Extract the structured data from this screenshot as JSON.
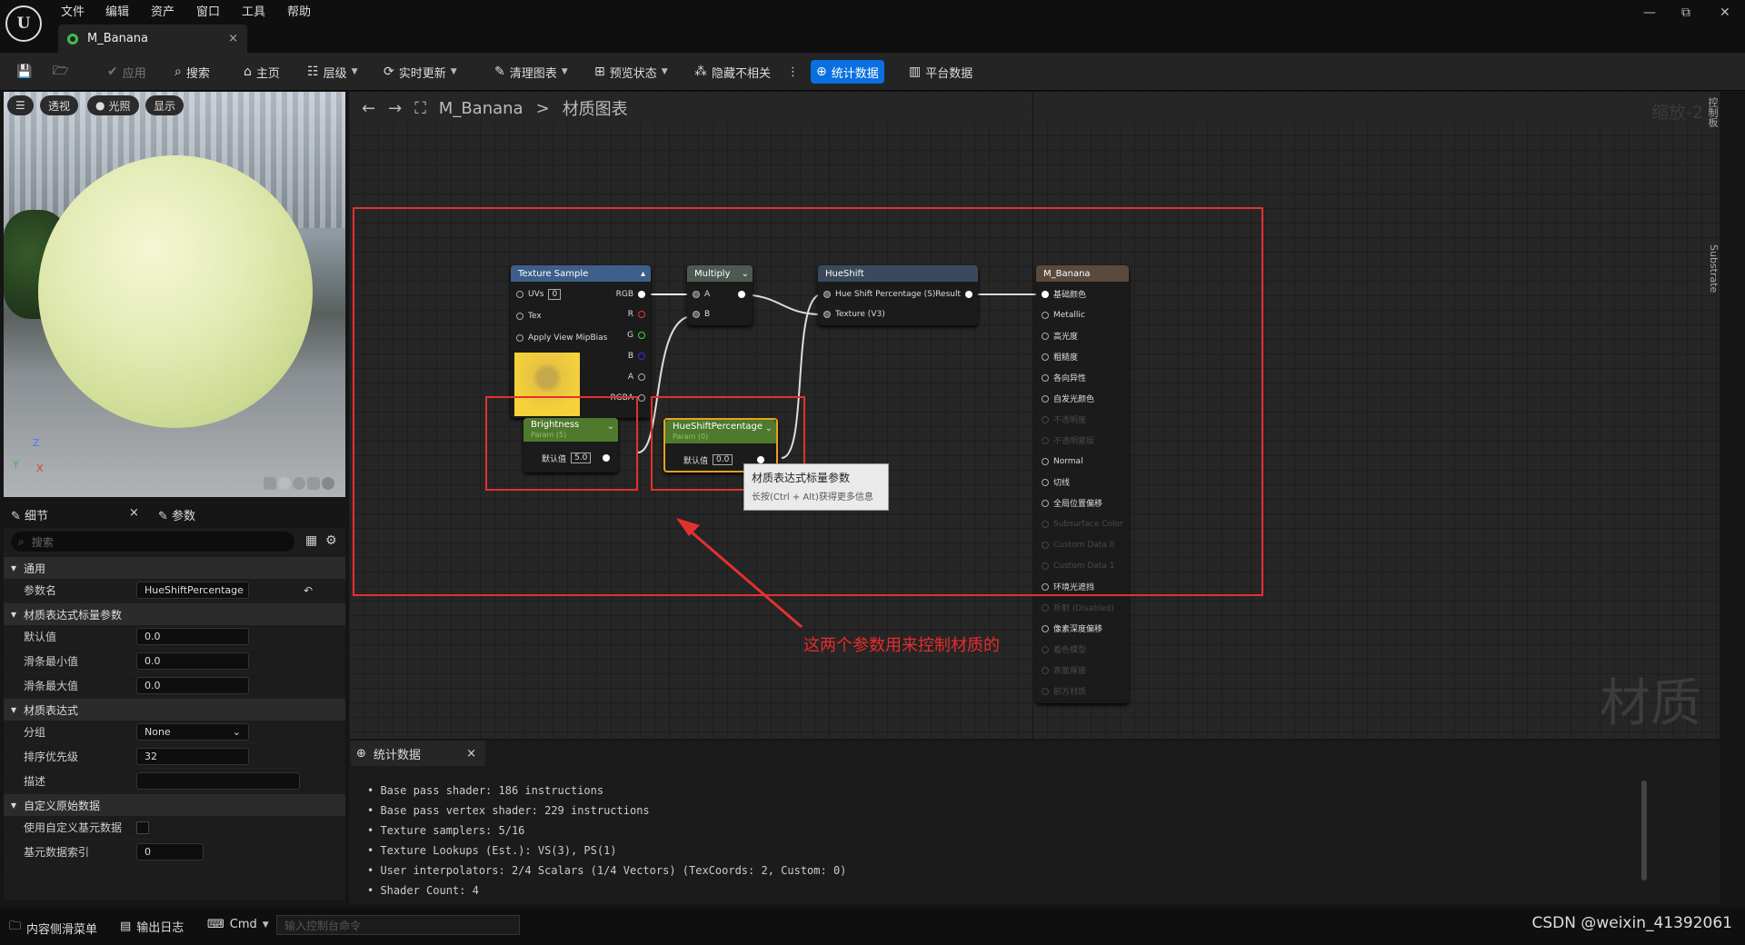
{
  "menu": {
    "items": [
      "文件",
      "编辑",
      "资产",
      "窗口",
      "工具",
      "帮助"
    ]
  },
  "doc_tab": {
    "title": "M_Banana",
    "close": "×"
  },
  "window_controls": {
    "minimize": "—",
    "restore": "⧉",
    "close": "✕"
  },
  "toolbar": {
    "save": "",
    "browse": "",
    "apply": "应用",
    "search": "搜索",
    "home": "主页",
    "hierarchy": "层级",
    "live_update": "实时更新",
    "clean_graph": "清理图表",
    "preview_state": "预览状态",
    "hide_unrelated": "隐藏不相关",
    "more": "⋮",
    "stats": "统计数据",
    "platform_stats": "平台数据"
  },
  "viewport": {
    "menu_label": "☰",
    "perspective": "透视",
    "lit": "光照",
    "show": "显示",
    "axis_z": "Z",
    "axis_x": "X",
    "axis_y": "Y"
  },
  "details": {
    "tab_details": "细节",
    "tab_params": "参数",
    "close": "×",
    "search_placeholder": "搜索",
    "sections": {
      "general": "通用",
      "scalar_param": "材质表达式标量参数",
      "expression": "材质表达式",
      "custom": "自定义原始数据"
    },
    "param_name_label": "参数名",
    "param_name_value": "HueShiftPercentage",
    "default_label": "默认值",
    "default_value": "0.0",
    "slider_min_label": "滑条最小值",
    "slider_min_value": "0.0",
    "slider_max_label": "滑条最大值",
    "slider_max_value": "0.0",
    "group_label": "分组",
    "group_value": "None",
    "priority_label": "排序优先级",
    "priority_value": "32",
    "desc_label": "描述",
    "desc_value": "",
    "use_custom_label": "使用自定义基元数据",
    "prim_index_label": "基元数据索引",
    "prim_index_value": "0"
  },
  "graph": {
    "back": "←",
    "forward": "→",
    "asset": "M_Banana",
    "sep": ">",
    "title": "材质图表",
    "zoom": "缩放-2",
    "watermark": "材质",
    "side_panel": "控制板",
    "side_substrate": "Substrate"
  },
  "nodes": {
    "texture_sample": {
      "title": "Texture Sample",
      "uvs": "UVs",
      "uvs_val": "0",
      "tex": "Tex",
      "mip": "Apply View MipBias",
      "rgb": "RGB",
      "r": "R",
      "g": "G",
      "b": "B",
      "a": "A",
      "rgba": "RGBA"
    },
    "multiply": {
      "title": "Multiply",
      "a": "A",
      "b": "B"
    },
    "hueshift": {
      "title": "HueShift",
      "in1": "Hue Shift Percentage (S)",
      "out": "Result",
      "in2": "Texture (V3)"
    },
    "brightness": {
      "title": "Brightness",
      "sub": "Param (5)",
      "label": "默认值",
      "value": "5.0"
    },
    "hueshift_param": {
      "title": "HueShiftPercentage",
      "sub": "Param (0)",
      "label": "默认值",
      "value": "0.0"
    },
    "result": {
      "title": "M_Banana",
      "pins": [
        "基础颜色",
        "Metallic",
        "高光度",
        "粗糙度",
        "各向异性",
        "自发光颜色",
        "不透明度",
        "不透明蒙版",
        "Normal",
        "切线",
        "全局位置偏移",
        "Subsurface Color",
        "Custom Data 0",
        "Custom Data 1",
        "环境光遮挡",
        "折射 (Disabled)",
        "像素深度偏移",
        "着色模型",
        "表面厚度",
        "前方材质"
      ],
      "dim": [
        false,
        false,
        false,
        false,
        false,
        false,
        true,
        true,
        false,
        false,
        false,
        true,
        true,
        true,
        false,
        true,
        false,
        true,
        true,
        true
      ]
    }
  },
  "tooltip": {
    "title": "材质表达式标量参数",
    "hint": "长按(Ctrl + Alt)获得更多信息"
  },
  "annotation": "这两个参数用来控制材质的",
  "stats": {
    "tab": "统计数据",
    "close": "×",
    "lines": [
      "Base pass shader: 186 instructions",
      "Base pass vertex shader: 229 instructions",
      "Texture samplers: 5/16",
      "Texture Lookups (Est.): VS(3), PS(1)",
      "User interpolators: 2/4 Scalars (1/4 Vectors) (TexCoords: 2, Custom: 0)",
      "Shader Count: 4"
    ]
  },
  "bottom": {
    "content_drawer": "内容侧滑菜单",
    "output_log": "输出日志",
    "cmd": "Cmd",
    "console_placeholder": "输入控制台命令",
    "watermark": "CSDN @weixin_41392061"
  },
  "colors": {
    "accent": "#0a6fe0",
    "annotation": "#e53030",
    "texture_header": "#3d5f8a",
    "multiply_header": "#4d5a52",
    "param_header": "#4e7a2d"
  }
}
